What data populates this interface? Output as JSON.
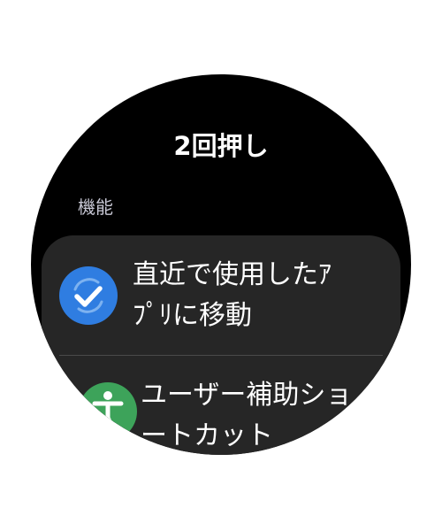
{
  "screen": {
    "title": "2回押し",
    "section_label": "機能"
  },
  "options": [
    {
      "label": "直近で使用したｱﾌﾟﾘに移動",
      "icon": "recent-apps-check-icon",
      "icon_color": "#2f7de1"
    },
    {
      "label": "ユーザー補助ショートカット",
      "icon": "accessibility-icon",
      "icon_color": "#3da35a"
    }
  ],
  "colors": {
    "background": "#000000",
    "card": "#262626",
    "section_label": "#c7c7d4"
  }
}
